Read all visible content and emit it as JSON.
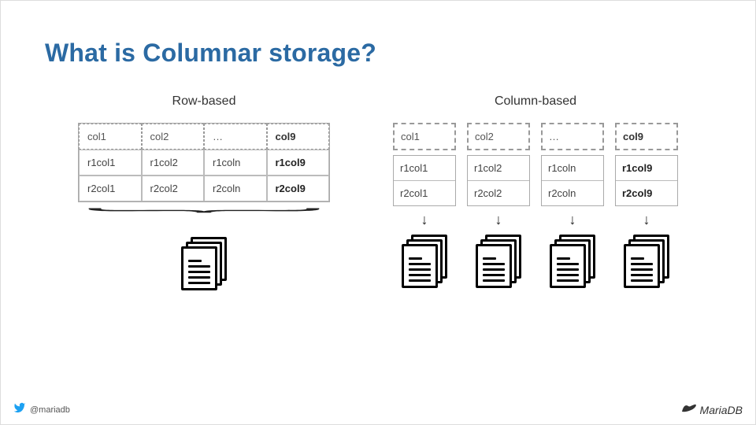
{
  "title": "What is Columnar storage?",
  "row_based": {
    "label": "Row-based",
    "headers": [
      "col1",
      "col2",
      "…",
      "col9"
    ],
    "header_bold_idx": 3,
    "rows": [
      [
        "r1col1",
        "r1col2",
        "r1coln",
        "r1col9"
      ],
      [
        "r2col1",
        "r2col2",
        "r2coln",
        "r2col9"
      ]
    ],
    "bold_col_idx": 3
  },
  "column_based": {
    "label": "Column-based",
    "columns": [
      {
        "header": "col1",
        "bold": false,
        "cells": [
          "r1col1",
          "r2col1"
        ]
      },
      {
        "header": "col2",
        "bold": false,
        "cells": [
          "r1col2",
          "r2col2"
        ]
      },
      {
        "header": "…",
        "bold": false,
        "cells": [
          "r1coln",
          "r2coln"
        ]
      },
      {
        "header": "col9",
        "bold": true,
        "cells": [
          "r1col9",
          "r2col9"
        ]
      }
    ]
  },
  "footer": {
    "handle": "@mariadb",
    "brand": "MariaDB"
  },
  "icons": {
    "twitter": "twitter-bird-icon",
    "brand": "seal-icon",
    "file": "file-stack-icon",
    "brace": "curly-brace-icon",
    "arrow": "arrow-down-icon"
  }
}
